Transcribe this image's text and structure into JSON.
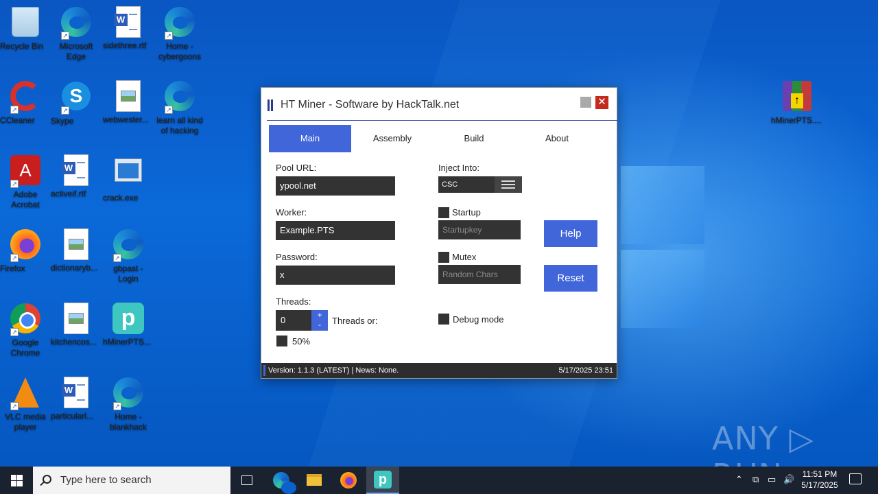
{
  "desktop": {
    "icons": [
      {
        "name": "Recycle Bin"
      },
      {
        "name": "Microsoft Edge"
      },
      {
        "name": "sidethree.rtf"
      },
      {
        "name": "Home - cybergoons"
      },
      {
        "name": "CCleaner"
      },
      {
        "name": "Skype"
      },
      {
        "name": "webwester..."
      },
      {
        "name": "learn all kind of hacking"
      },
      {
        "name": "Adobe Acrobat"
      },
      {
        "name": "activeif.rtf"
      },
      {
        "name": "crack.exe"
      },
      {
        "name": "Firefox"
      },
      {
        "name": "dictionaryb..."
      },
      {
        "name": "gbpast - Login"
      },
      {
        "name": "Google Chrome"
      },
      {
        "name": "kitchencos..."
      },
      {
        "name": "hMinerPTS..."
      },
      {
        "name": "VLC media player"
      },
      {
        "name": "particularl..."
      },
      {
        "name": "Home - blankhack"
      },
      {
        "name": "hMinerPTS...."
      }
    ]
  },
  "window": {
    "title": "HT Miner - Software by HackTalk.net",
    "close_glyph": "✕",
    "tabs": [
      {
        "label": "Main",
        "active": true
      },
      {
        "label": "Assembly",
        "active": false
      },
      {
        "label": "Build",
        "active": false
      },
      {
        "label": "About",
        "active": false
      }
    ],
    "pool_url": {
      "label": "Pool URL:",
      "value": "ypool.net"
    },
    "worker": {
      "label": "Worker:",
      "value": "Example.PTS"
    },
    "password": {
      "label": "Password:",
      "value": "x"
    },
    "threads": {
      "label": "Threads:",
      "value": "0",
      "plus": "+",
      "minus": "-",
      "or_label": "Threads or:",
      "percent_label": "50%",
      "percent_checked": false
    },
    "inject": {
      "label": "Inject Into:",
      "value": "CSC"
    },
    "startup": {
      "label": "Startup",
      "checked": false,
      "placeholder": "Startupkey"
    },
    "mutex": {
      "label": "Mutex",
      "checked": false,
      "placeholder": "Random Chars"
    },
    "debug": {
      "label": "Debug mode",
      "checked": false
    },
    "buttons": {
      "help": "Help",
      "reset": "Reset"
    },
    "status": {
      "left": "Version: 1.1.3 (LATEST) | News: None.",
      "right": "5/17/2025 23:51"
    },
    "accent_color": "#4166d9"
  },
  "watermark": "ANY ▷ RUN",
  "taskbar": {
    "search_placeholder": "Type here to search",
    "apps": [
      "task-view",
      "edge",
      "file-explorer",
      "firefox",
      "hminer"
    ],
    "active_app": "hminer",
    "clock_time": "11:51 PM",
    "clock_date": "5/17/2025"
  }
}
